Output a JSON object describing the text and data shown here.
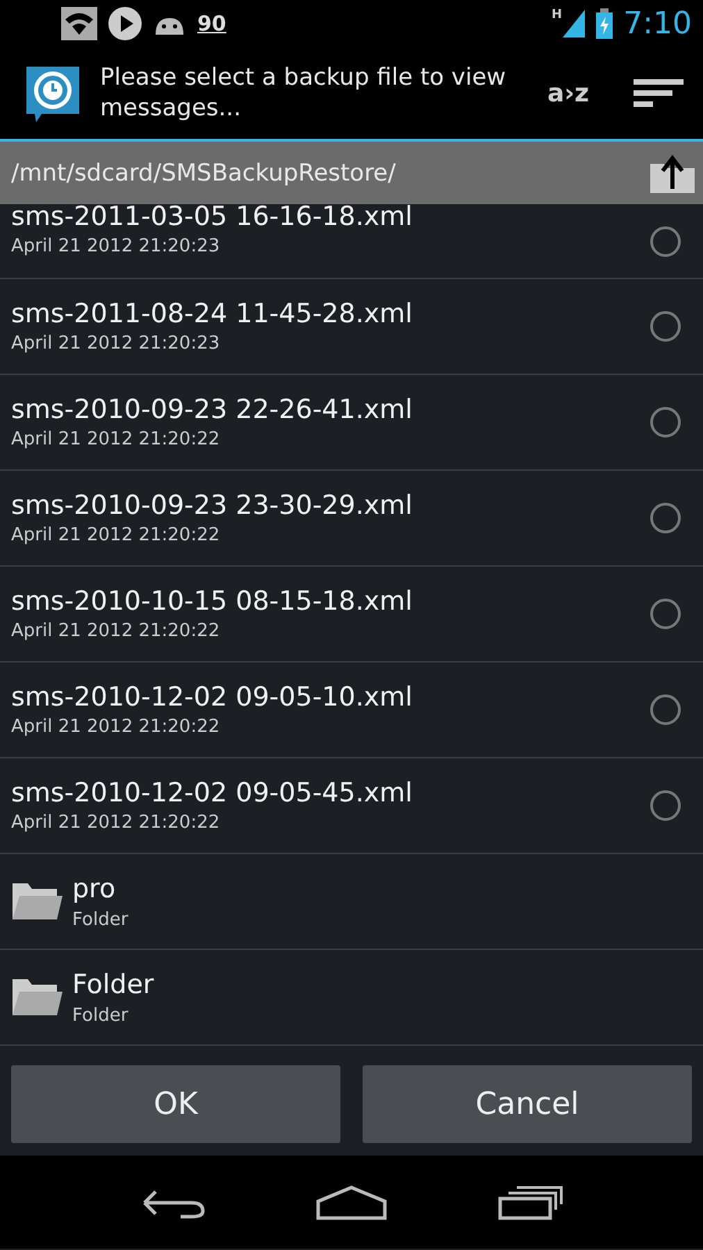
{
  "status_bar": {
    "notification_count": "90",
    "network_type": "H",
    "time": "7:10"
  },
  "action_bar": {
    "title": "Please select a backup file to view messages...",
    "sort_label": "a›z"
  },
  "path_bar": {
    "path": "/mnt/sdcard/SMSBackupRestore/"
  },
  "files": [
    {
      "kind": "file",
      "name": "sms-2011-03-05 16-16-18.xml",
      "detail": "April 21 2012 21:20:23",
      "selected": false
    },
    {
      "kind": "file",
      "name": "sms-2011-08-24 11-45-28.xml",
      "detail": "April 21 2012 21:20:23",
      "selected": false
    },
    {
      "kind": "file",
      "name": "sms-2010-09-23 22-26-41.xml",
      "detail": "April 21 2012 21:20:22",
      "selected": false
    },
    {
      "kind": "file",
      "name": "sms-2010-09-23 23-30-29.xml",
      "detail": "April 21 2012 21:20:22",
      "selected": false
    },
    {
      "kind": "file",
      "name": "sms-2010-10-15 08-15-18.xml",
      "detail": "April 21 2012 21:20:22",
      "selected": false
    },
    {
      "kind": "file",
      "name": "sms-2010-12-02 09-05-10.xml",
      "detail": "April 21 2012 21:20:22",
      "selected": false
    },
    {
      "kind": "file",
      "name": "sms-2010-12-02 09-05-45.xml",
      "detail": "April 21 2012 21:20:22",
      "selected": false
    },
    {
      "kind": "folder",
      "name": "pro",
      "detail": "Folder"
    },
    {
      "kind": "folder",
      "name": "Folder",
      "detail": "Folder"
    }
  ],
  "buttons": [
    "OK",
    "Cancel"
  ]
}
